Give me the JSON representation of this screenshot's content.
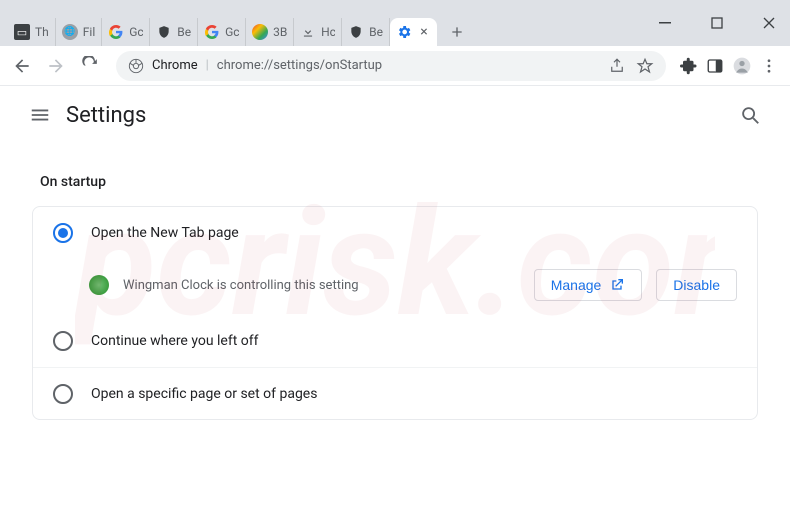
{
  "window": {
    "tabs": [
      {
        "label": "Th",
        "favicon": "doc"
      },
      {
        "label": "Fil",
        "favicon": "globe"
      },
      {
        "label": "Gc",
        "favicon": "google"
      },
      {
        "label": "Be",
        "favicon": "shield"
      },
      {
        "label": "Gc",
        "favicon": "google"
      },
      {
        "label": "3B",
        "favicon": "rainbow"
      },
      {
        "label": "Hc",
        "favicon": "download"
      },
      {
        "label": "Be",
        "favicon": "shield"
      }
    ],
    "active_tab_label": "Settings"
  },
  "omnibox": {
    "chip": "Chrome",
    "url_path": "chrome://settings/onStartup"
  },
  "header": {
    "title": "Settings"
  },
  "section": {
    "title": "On startup",
    "options": [
      {
        "label": "Open the New Tab page",
        "selected": true
      },
      {
        "label": "Continue where you left off",
        "selected": false
      },
      {
        "label": "Open a specific page or set of pages",
        "selected": false
      }
    ],
    "extension_notice": {
      "text": "Wingman Clock is controlling this setting",
      "manage_label": "Manage",
      "disable_label": "Disable"
    }
  }
}
